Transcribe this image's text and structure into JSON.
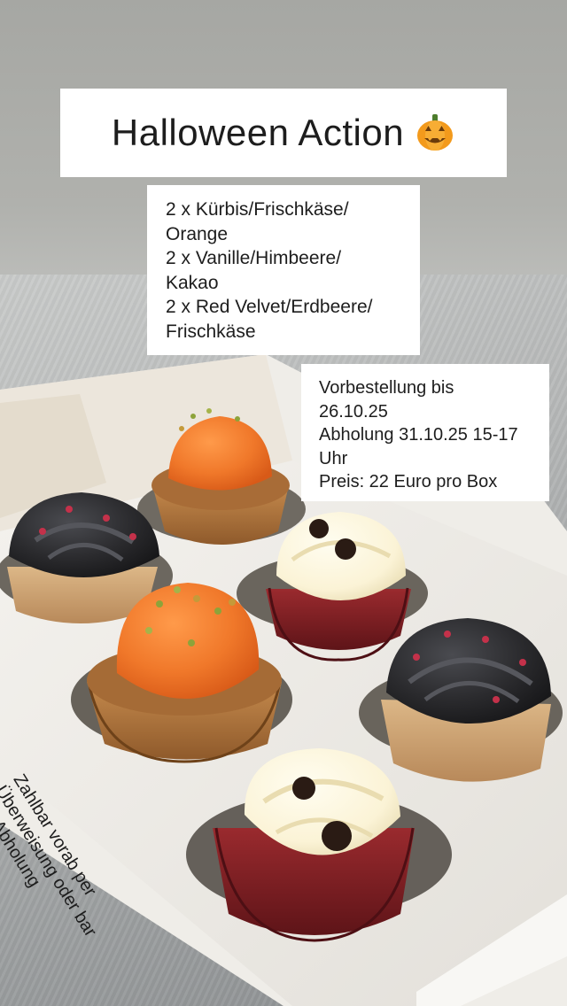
{
  "title": {
    "text": "Halloween Action",
    "emoji_icon": "jack-o-lantern-icon"
  },
  "flavors": [
    "2 x Kürbis/Frischkäse/",
    "Orange",
    "2 x Vanille/Himbeere/",
    "Kakao",
    "2 x Red Velvet/Erdbeere/",
    "Frischkäse"
  ],
  "order_info": [
    "Vorbestellung bis",
    "26.10.25",
    "Abholung 31.10.25 15-17",
    "Uhr",
    "Preis: 22 Euro pro Box"
  ],
  "payment_note": [
    "Zahlbar vorab per",
    "Überweisung oder bar",
    "bei Abholung"
  ],
  "colors": {
    "card_background": "#ffffff",
    "text": "#1d1d1d",
    "orange_frosting": "#f0782a",
    "black_frosting": "#2b2b2e",
    "vanilla_frosting": "#fbf3d6",
    "red_velvet": "#7e1c22",
    "cake_brown": "#b0763e"
  }
}
